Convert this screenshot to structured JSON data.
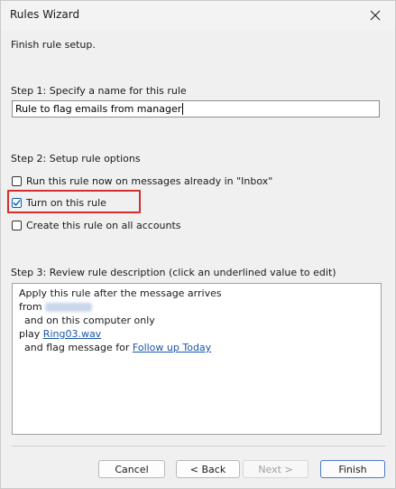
{
  "window": {
    "title": "Rules Wizard"
  },
  "intro": "Finish rule setup.",
  "step1": {
    "label": "Step 1: Specify a name for this rule",
    "name_value": "Rule to flag emails from manager"
  },
  "step2": {
    "label": "Step 2: Setup rule options",
    "options": [
      {
        "label": "Run this rule now on messages already in \"Inbox\"",
        "checked": false
      },
      {
        "label": "Turn on this rule",
        "checked": true
      },
      {
        "label": "Create this rule on all accounts",
        "checked": false
      }
    ]
  },
  "step3": {
    "label": "Step 3: Review rule description (click an underlined value to edit)",
    "lines": {
      "line1": "Apply this rule after the message arrives",
      "line2_prefix": "from",
      "line3": "and on this computer only",
      "line4_prefix": "play",
      "line4_link": "Ring03.wav",
      "line5_prefix": "and flag message for",
      "line5_link": "Follow up Today"
    }
  },
  "buttons": {
    "cancel": "Cancel",
    "back": "< Back",
    "next": "Next >",
    "finish": "Finish"
  },
  "colors": {
    "highlight": "#d32f2f",
    "link": "#1a56a8",
    "check_accent": "#005fb8"
  }
}
